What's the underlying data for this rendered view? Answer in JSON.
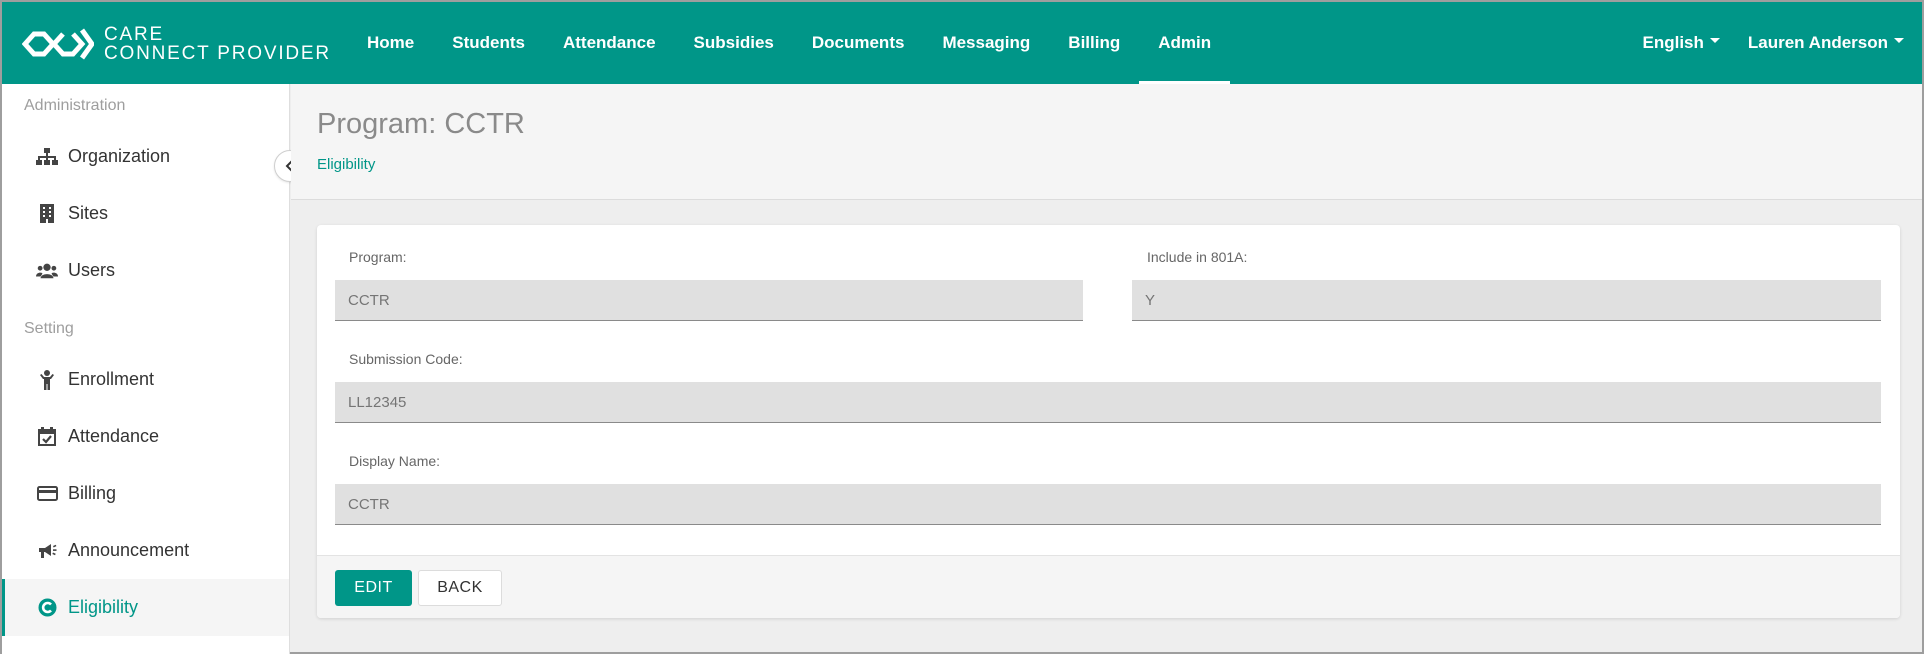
{
  "brand": {
    "line1": "CARE",
    "line2": "CONNECT PROVIDER"
  },
  "nav": {
    "items": [
      {
        "label": "Home"
      },
      {
        "label": "Students"
      },
      {
        "label": "Attendance"
      },
      {
        "label": "Subsidies"
      },
      {
        "label": "Documents"
      },
      {
        "label": "Messaging"
      },
      {
        "label": "Billing"
      },
      {
        "label": "Admin"
      }
    ],
    "active": "Admin",
    "language": "English",
    "user": "Lauren Anderson"
  },
  "sidebar": {
    "section1": "Administration",
    "section1_items": [
      {
        "label": "Organization",
        "icon": "sitemap-icon"
      },
      {
        "label": "Sites",
        "icon": "building-icon"
      },
      {
        "label": "Users",
        "icon": "users-icon"
      }
    ],
    "section2": "Setting",
    "section2_items": [
      {
        "label": "Enrollment",
        "icon": "child-icon"
      },
      {
        "label": "Attendance",
        "icon": "calendar-check-icon"
      },
      {
        "label": "Billing",
        "icon": "credit-card-icon"
      },
      {
        "label": "Announcement",
        "icon": "megaphone-icon"
      },
      {
        "label": "Eligibility",
        "icon": "eligibility-icon"
      }
    ],
    "active": "Eligibility"
  },
  "page": {
    "title": "Program: CCTR",
    "breadcrumb": "Eligibility"
  },
  "form": {
    "program_label": "Program:",
    "program_value": "CCTR",
    "include_label": "Include in 801A:",
    "include_value": "Y",
    "submission_label": "Submission Code:",
    "submission_value": "LL12345",
    "display_label": "Display Name:",
    "display_value": "CCTR"
  },
  "actions": {
    "edit": "EDIT",
    "back": "BACK"
  },
  "colors": {
    "primary": "#009688",
    "field_bg": "#e0e0e0",
    "page_bg": "#eeeeee"
  }
}
